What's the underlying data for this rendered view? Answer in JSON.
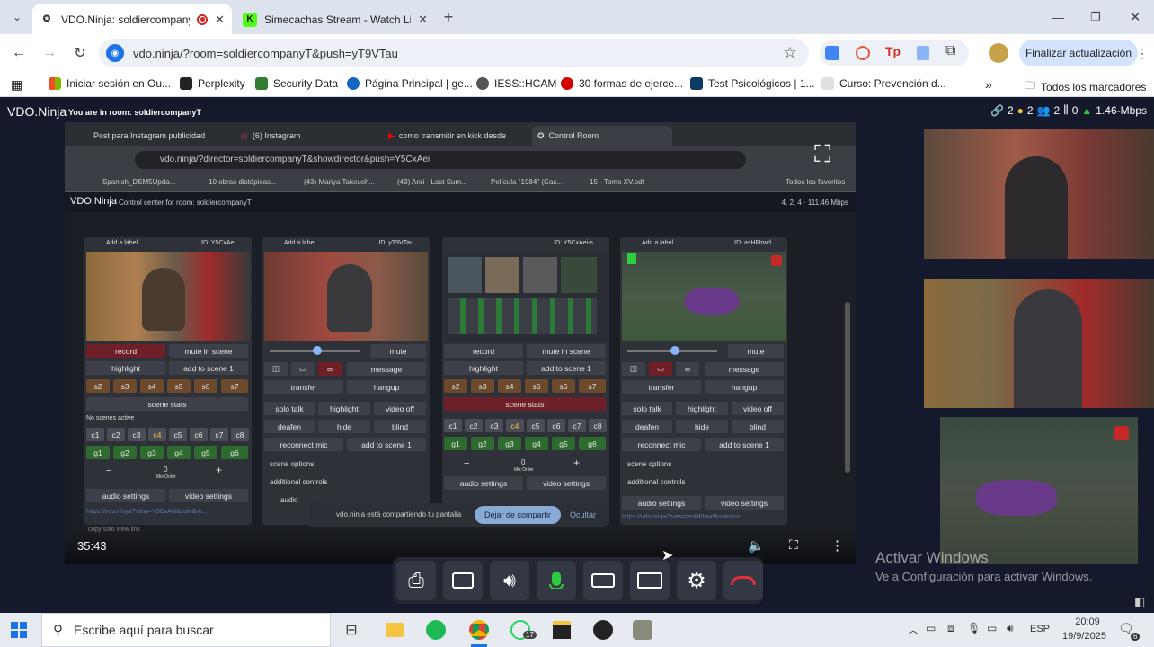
{
  "browser": {
    "tabs": [
      {
        "title": "VDO.Ninja: soldiercompany",
        "active": true
      },
      {
        "title": "Simecachas Stream - Watch Li",
        "active": false
      }
    ],
    "url": "vdo.ninja/?room=soldiercompanyT&push=yT9VTau",
    "update_button": "Finalizar actualización",
    "bookmarks": [
      "Iniciar sesión en Ou...",
      "Perplexity",
      "Security Data",
      "Página Principal | ge...",
      "IESS::HCAM",
      "30 formas de ejerce...",
      "Test Psicológicos | 1...",
      "Curso: Prevención d..."
    ],
    "all_bookmarks": "Todos los marcadores"
  },
  "vdo": {
    "brand": "VDO.Ninja",
    "room_notice": "You are in room: soldiercompanyT",
    "stats": [
      "2",
      "2",
      "2",
      "0",
      "1.46-Mbps"
    ]
  },
  "screen": {
    "inner_tabs": [
      "Post para Instagram publicidad",
      "(6) Instagram",
      "como transmitir en kick desde",
      "Control Room"
    ],
    "inner_url": "vdo.ninja/?director=soldiercompanyT&showdirector&push=Y5CxAei",
    "inner_bookmarks": [
      "Spanish_DSM5Upda...",
      "10 obras distópicas...",
      "(43) Mariya Takeuch...",
      "(43) Anri - Last Sum...",
      "Película \"1984\" (Cas...",
      "15 - Tomo XV.pdf",
      "Todos los favoritos"
    ],
    "control_title": "VDO.Ninja",
    "control_sub": "Control center for room: soldiercompanyT",
    "control_stats": "4, 2, 4 · 111.46 Mbps",
    "cards": [
      {
        "label": "Add a label",
        "id": "ID: Y5CxAei"
      },
      {
        "label": "Add a label",
        "id": "ID: yT9VTau"
      },
      {
        "label": "",
        "id": "ID: Y5CxAei-s"
      },
      {
        "label": "Add a label",
        "id": "ID: asHFtrwd"
      }
    ],
    "buttons": {
      "record": "record",
      "mute_scene": "mute in scene",
      "highlight": "highlight",
      "add_scene": "add to scene 1",
      "scene_stats": "scene stats",
      "no_scenes": "No scenes active",
      "mute": "mute",
      "message": "message",
      "transfer": "transfer",
      "hangup": "hangup",
      "solo_talk": "solo talk",
      "video_off": "video off",
      "deafen": "deafen",
      "hide": "hide",
      "blind": "blind",
      "reconnect": "reconnect mic",
      "scene_options": "scene options",
      "additional": "additional controls",
      "audio_settings": "audio settings",
      "video_settings": "video settings",
      "audio": "audio",
      "mix_order": "Mix Order",
      "zero": "0"
    },
    "scenes": [
      "s2",
      "s3",
      "s4",
      "s5",
      "s6",
      "s7"
    ],
    "cscenes": [
      "c1",
      "c2",
      "c3",
      "c4",
      "c5",
      "c6",
      "c7",
      "c8"
    ],
    "gscenes": [
      "g1",
      "g2",
      "g3",
      "g4",
      "g5",
      "g6"
    ],
    "link1": "https://vdo.ninja/?view=Y5CxAei&solo&ro...",
    "link4": "https://vdo.ninja/?view=asHFtrwd&solo&ro...",
    "copy_link": "copy solo view link",
    "share_notice": "vdo.ninja está compartiendo tu pantalla",
    "stop_share": "Dejar de compartir",
    "hide_share": "Ocultar",
    "timer": "35:43"
  },
  "watermark": {
    "line1": "Activar Windows",
    "line2": "Ve a Configuración para activar Windows."
  },
  "taskbar": {
    "search_placeholder": "Escribe aquí para buscar",
    "lang": "ESP",
    "time": "20:09",
    "date": "19/9/2025",
    "whatsapp_badge": "17",
    "notif_badge": "6"
  },
  "colors": {
    "vdo_bg": "#141a2b",
    "mic_green": "#2ecc40",
    "hangup_red": "#e0303a",
    "stop_share_blue": "#8aaad6"
  }
}
